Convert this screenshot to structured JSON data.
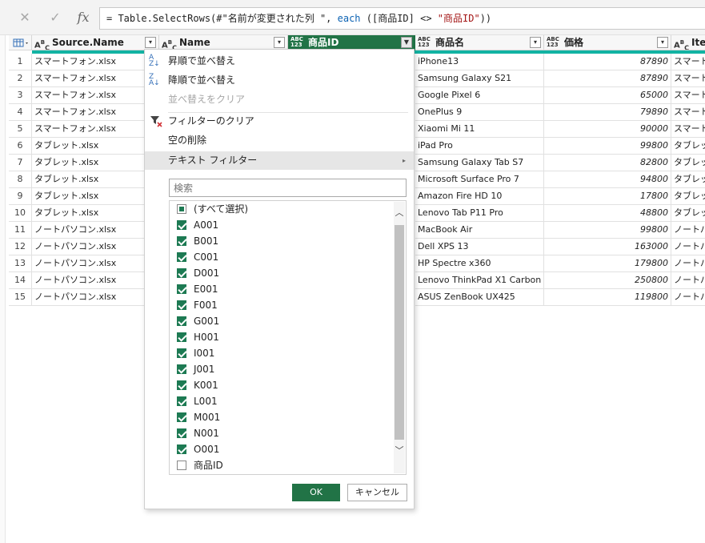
{
  "formula_bar": {
    "cancel_icon": "close-icon",
    "confirm_icon": "check-icon",
    "fx_label": "fx",
    "formula_parts": [
      {
        "text": "= Table.SelectRows(#\"名前が変更された列 \", ",
        "style": "plain"
      },
      {
        "text": "each",
        "style": "kw"
      },
      {
        "text": " ([商品ID] <> ",
        "style": "plain"
      },
      {
        "text": "\"商品ID\"",
        "style": "str"
      },
      {
        "text": "))",
        "style": "plain"
      }
    ]
  },
  "columns": [
    {
      "label": "Source.Name",
      "type_icon": "ABC",
      "selected": false
    },
    {
      "label": "Name",
      "type_icon": "ABC",
      "selected": false
    },
    {
      "label": "商品ID",
      "type_icon": "ABC 123",
      "selected": true
    },
    {
      "label": "商品名",
      "type_icon": "ABC 123",
      "selected": false
    },
    {
      "label": "価格",
      "type_icon": "ABC 123",
      "selected": false
    },
    {
      "label": "Item",
      "type_icon": "ABC",
      "selected": false
    }
  ],
  "rows": [
    {
      "no": "1",
      "source": "スマートフォン.xlsx",
      "product": "iPhone13",
      "price": "87890",
      "item": "スマート"
    },
    {
      "no": "2",
      "source": "スマートフォン.xlsx",
      "product": "Samsung Galaxy S21",
      "price": "87890",
      "item": "スマート"
    },
    {
      "no": "3",
      "source": "スマートフォン.xlsx",
      "product": "Google Pixel 6",
      "price": "65000",
      "item": "スマート"
    },
    {
      "no": "4",
      "source": "スマートフォン.xlsx",
      "product": "OnePlus 9",
      "price": "79890",
      "item": "スマート"
    },
    {
      "no": "5",
      "source": "スマートフォン.xlsx",
      "product": "Xiaomi Mi 11",
      "price": "90000",
      "item": "スマート"
    },
    {
      "no": "6",
      "source": "タブレット.xlsx",
      "product": "iPad Pro",
      "price": "99800",
      "item": "タブレッ"
    },
    {
      "no": "7",
      "source": "タブレット.xlsx",
      "product": "Samsung Galaxy Tab S7",
      "price": "82800",
      "item": "タブレッ"
    },
    {
      "no": "8",
      "source": "タブレット.xlsx",
      "product": "Microsoft Surface Pro 7",
      "price": "94800",
      "item": "タブレッ"
    },
    {
      "no": "9",
      "source": "タブレット.xlsx",
      "product": "Amazon Fire HD 10",
      "price": "17800",
      "item": "タブレッ"
    },
    {
      "no": "10",
      "source": "タブレット.xlsx",
      "product": "Lenovo Tab P11 Pro",
      "price": "48800",
      "item": "タブレッ"
    },
    {
      "no": "11",
      "source": "ノートパソコン.xlsx",
      "product": "MacBook Air",
      "price": "99800",
      "item": "ノートパ"
    },
    {
      "no": "12",
      "source": "ノートパソコン.xlsx",
      "product": "Dell XPS 13",
      "price": "163000",
      "item": "ノートパ"
    },
    {
      "no": "13",
      "source": "ノートパソコン.xlsx",
      "product": "HP Spectre x360",
      "price": "179800",
      "item": "ノートパ"
    },
    {
      "no": "14",
      "source": "ノートパソコン.xlsx",
      "product": "Lenovo ThinkPad X1 Carbon",
      "price": "250800",
      "item": "ノートパ"
    },
    {
      "no": "15",
      "source": "ノートパソコン.xlsx",
      "product": "ASUS ZenBook UX425",
      "price": "119800",
      "item": "ノートパ"
    }
  ],
  "filter_menu": {
    "sort_asc": "昇順で並べ替え",
    "sort_desc": "降順で並べ替え",
    "clear_sort": "並べ替えをクリア",
    "clear_filter": "フィルターのクリア",
    "remove_empty": "空の削除",
    "text_filters": "テキスト フィルター",
    "search_placeholder": "検索",
    "select_all": "(すべて選択)",
    "items": [
      {
        "label": "A001",
        "checked": true
      },
      {
        "label": "B001",
        "checked": true
      },
      {
        "label": "C001",
        "checked": true
      },
      {
        "label": "D001",
        "checked": true
      },
      {
        "label": "E001",
        "checked": true
      },
      {
        "label": "F001",
        "checked": true
      },
      {
        "label": "G001",
        "checked": true
      },
      {
        "label": "H001",
        "checked": true
      },
      {
        "label": "I001",
        "checked": true
      },
      {
        "label": "J001",
        "checked": true
      },
      {
        "label": "K001",
        "checked": true
      },
      {
        "label": "L001",
        "checked": true
      },
      {
        "label": "M001",
        "checked": true
      },
      {
        "label": "N001",
        "checked": true
      },
      {
        "label": "O001",
        "checked": true
      },
      {
        "label": "商品ID",
        "checked": false
      }
    ],
    "ok": "OK",
    "cancel": "キャンセル"
  },
  "colors": {
    "accent": "#217346",
    "quality_bar": "#12b3a3"
  }
}
